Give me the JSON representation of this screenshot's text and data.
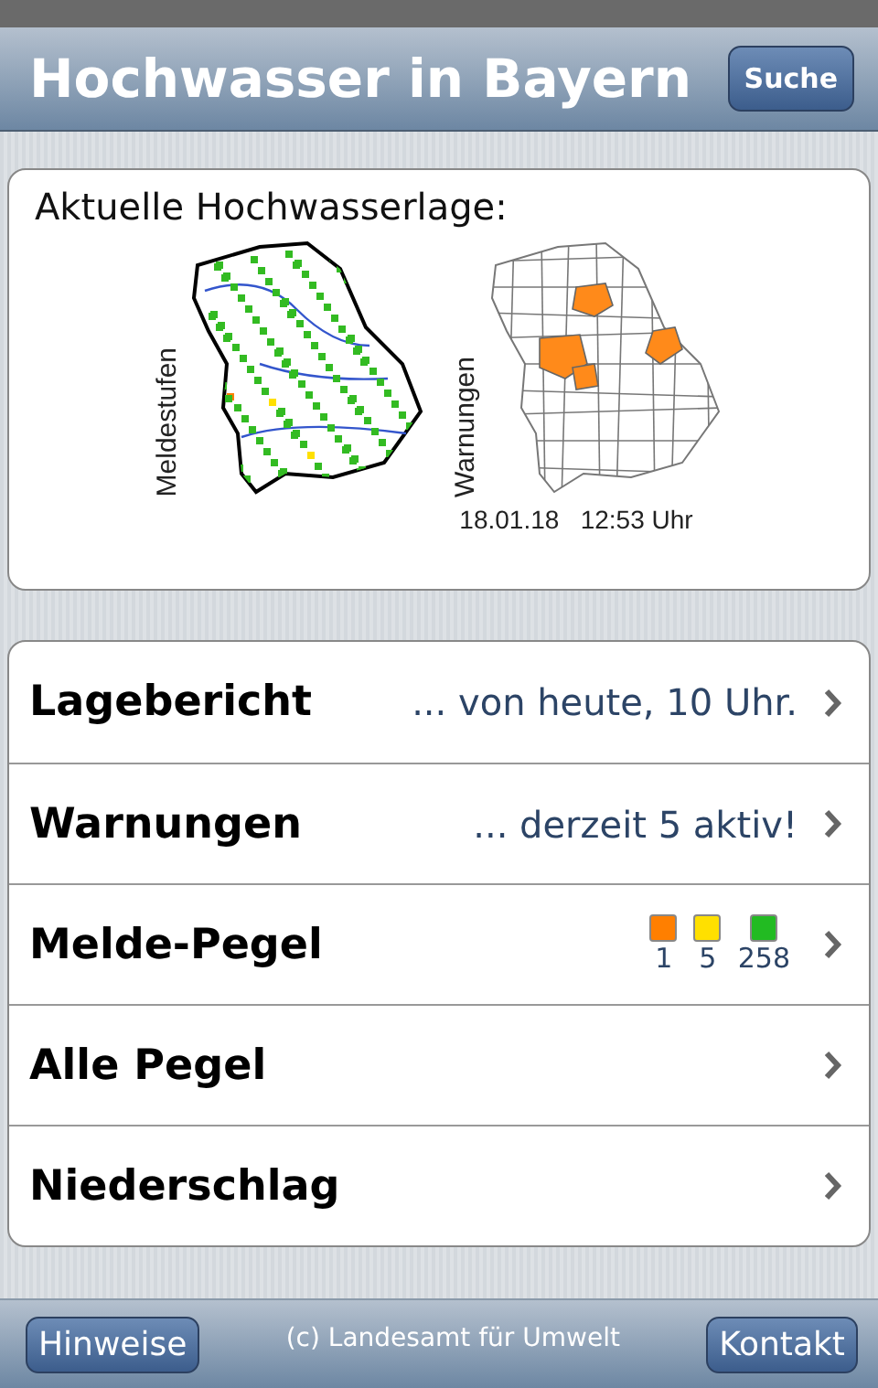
{
  "header": {
    "title": "Hochwasser in Bayern",
    "button": "Suche"
  },
  "overview": {
    "title": "Aktuelle Hochwasserlage:",
    "maps": [
      {
        "kind": "levels",
        "label": "Meldestufen"
      },
      {
        "kind": "warnings",
        "label": "Warnungen"
      }
    ],
    "timestamp": "18.01.18   12:53 Uhr"
  },
  "menu": [
    {
      "kind": "text",
      "label": "Lagebericht",
      "value": "... von heute, 10 Uhr."
    },
    {
      "kind": "text",
      "label": "Warnungen",
      "value": "... derzeit 5 aktiv!"
    },
    {
      "kind": "legend",
      "label": "Melde-Pegel",
      "legend": [
        {
          "color": "#ff7f00",
          "count": "1"
        },
        {
          "color": "#ffe000",
          "count": "5"
        },
        {
          "color": "#22bb22",
          "count": "258"
        }
      ]
    },
    {
      "kind": "plain",
      "label": "Alle Pegel"
    },
    {
      "kind": "plain",
      "label": "Niederschlag"
    }
  ],
  "footer": {
    "left_button": "Hinweise",
    "copyright": "(c) Landesamt für Umwelt",
    "right_button": "Kontakt"
  }
}
